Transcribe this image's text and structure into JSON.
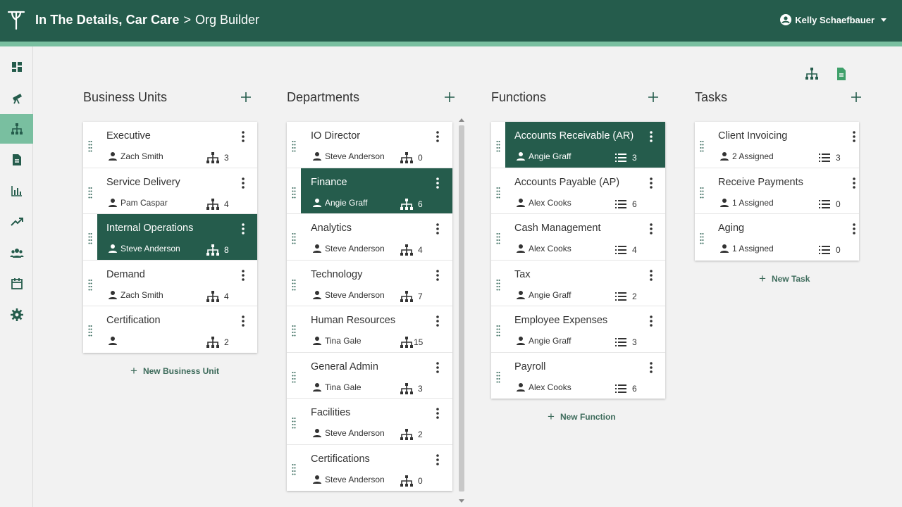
{
  "header": {
    "company": "In The Details, Car Care",
    "separator": ">",
    "page": "Org Builder",
    "user_name": "Kelly Schaefbauer",
    "icons": {
      "logo": "logo-icon",
      "user": "account-circle-icon",
      "dropdown": "caret-down-icon"
    }
  },
  "colors": {
    "primary": "#255c4c",
    "accent": "#79bfa0",
    "background": "#f2f2f2",
    "card": "#ffffff"
  },
  "sidebar": {
    "items": [
      {
        "icon": "dashboard-icon",
        "active": false
      },
      {
        "icon": "telescope-icon",
        "active": false
      },
      {
        "icon": "org-chart-icon",
        "active": true
      },
      {
        "icon": "document-icon",
        "active": false
      },
      {
        "icon": "bar-chart-icon",
        "active": false
      },
      {
        "icon": "trending-up-icon",
        "active": false
      },
      {
        "icon": "people-icon",
        "active": false
      },
      {
        "icon": "calendar-icon",
        "active": false
      },
      {
        "icon": "gear-icon",
        "active": false
      }
    ]
  },
  "tools": {
    "org_chart": "org-chart-icon",
    "document": "document-icon"
  },
  "business_units": {
    "title": "Business Units",
    "new_label": "New Business Unit",
    "items": [
      {
        "name": "Executive",
        "person": "Zach Smith",
        "count": "3"
      },
      {
        "name": "Service Delivery",
        "person": "Pam Caspar",
        "count": "4"
      },
      {
        "name": "Internal Operations",
        "person": "Steve Anderson",
        "count": "8"
      },
      {
        "name": "Demand",
        "person": "Zach Smith",
        "count": "4"
      },
      {
        "name": "Certification",
        "person": "",
        "count": "2"
      }
    ]
  },
  "departments": {
    "title": "Departments",
    "items": [
      {
        "name": "IO Director",
        "person": "Steve Anderson",
        "count": "0"
      },
      {
        "name": "Finance",
        "person": "Angie Graff",
        "count": "6"
      },
      {
        "name": "Analytics",
        "person": "Steve Anderson",
        "count": "4"
      },
      {
        "name": "Technology",
        "person": "Steve Anderson",
        "count": "7"
      },
      {
        "name": "Human Resources",
        "person": "Tina Gale",
        "count": "15"
      },
      {
        "name": "General Admin",
        "person": "Tina Gale",
        "count": "3"
      },
      {
        "name": "Facilities",
        "person": "Steve Anderson",
        "count": "2"
      },
      {
        "name": "Certifications",
        "person": "Steve Anderson",
        "count": "0"
      }
    ]
  },
  "functions": {
    "title": "Functions",
    "new_label": "New Function",
    "items": [
      {
        "name": "Accounts Receivable (AR)",
        "person": "Angie Graff",
        "count": "3"
      },
      {
        "name": "Accounts Payable (AP)",
        "person": "Alex Cooks",
        "count": "6"
      },
      {
        "name": "Cash Management",
        "person": "Alex Cooks",
        "count": "4"
      },
      {
        "name": "Tax",
        "person": "Angie Graff",
        "count": "2"
      },
      {
        "name": "Employee Expenses",
        "person": "Angie Graff",
        "count": "3"
      },
      {
        "name": "Payroll",
        "person": "Alex Cooks",
        "count": "6"
      }
    ]
  },
  "tasks": {
    "title": "Tasks",
    "new_label": "New Task",
    "items": [
      {
        "name": "Client Invoicing",
        "person": "2 Assigned",
        "count": "3"
      },
      {
        "name": "Receive Payments",
        "person": "1 Assigned",
        "count": "0"
      },
      {
        "name": "Aging",
        "person": "1 Assigned",
        "count": "0"
      }
    ]
  }
}
